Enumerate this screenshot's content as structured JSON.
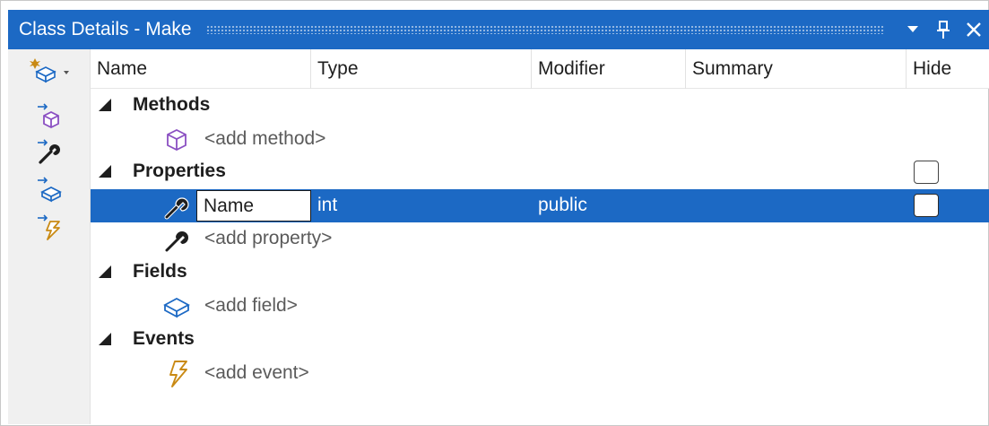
{
  "window": {
    "title": "Class Details - Make",
    "title_bar_color": "#1c69c4",
    "controls": [
      "chevron-down-icon",
      "pin-icon",
      "close-icon"
    ]
  },
  "toolbar": {
    "tools": [
      "new-member-dropdown-icon",
      "new-method-icon",
      "new-property-icon",
      "new-field-icon",
      "new-event-icon"
    ]
  },
  "columns": {
    "name": "Name",
    "type": "Type",
    "modifier": "Modifier",
    "summary": "Summary",
    "hide": "Hide"
  },
  "groups": {
    "methods": {
      "label": "Methods",
      "add_label": "<add method>"
    },
    "properties": {
      "label": "Properties",
      "hide_checked": false,
      "items": [
        {
          "name": "Name",
          "type": "int",
          "modifier": "public",
          "summary": "",
          "hide": false,
          "selected": true
        }
      ],
      "add_label": "<add property>"
    },
    "fields": {
      "label": "Fields",
      "add_label": "<add field>"
    },
    "events": {
      "label": "Events",
      "add_label": "<add event>"
    }
  },
  "colors": {
    "selection": "#1c69c4",
    "method_icon": "#8a4fc2",
    "field_icon": "#1c69c4",
    "event_icon": "#c98a14"
  }
}
